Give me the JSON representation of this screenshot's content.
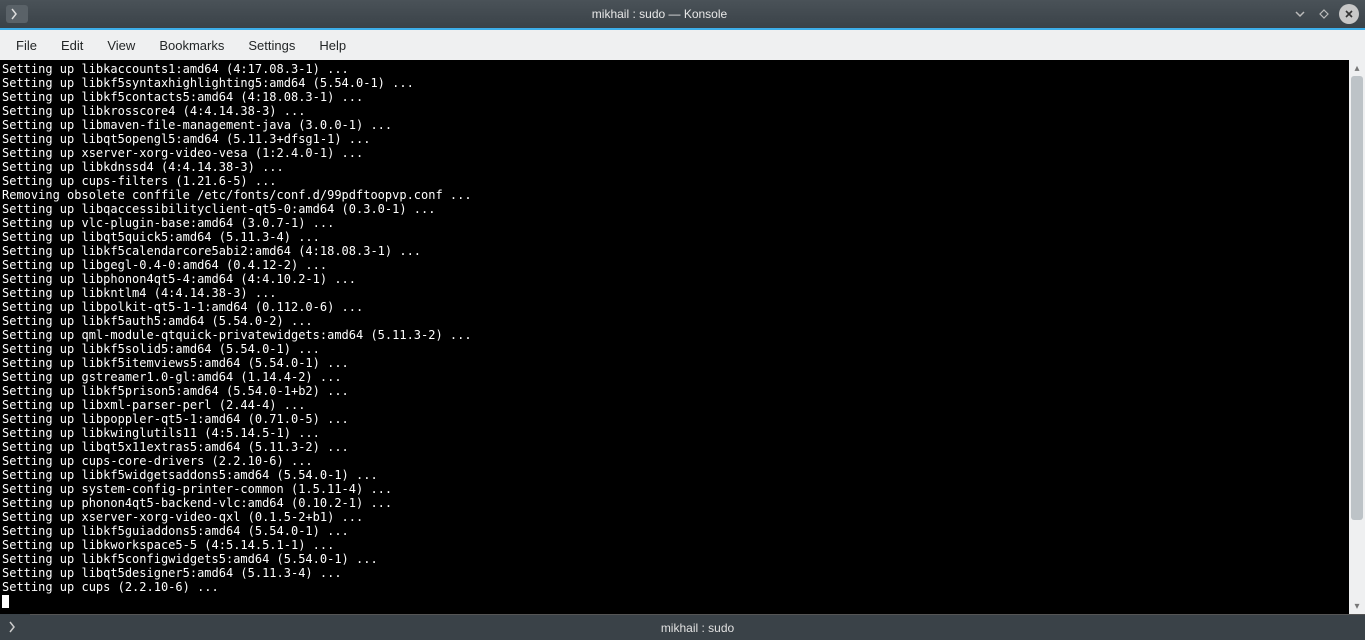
{
  "titlebar": {
    "title": "mikhail : sudo — Konsole"
  },
  "menu": {
    "file": "File",
    "edit": "Edit",
    "view": "View",
    "bookmarks": "Bookmarks",
    "settings": "Settings",
    "help": "Help"
  },
  "terminal_lines": [
    "Setting up libkaccounts1:amd64 (4:17.08.3-1) ...",
    "Setting up libkf5syntaxhighlighting5:amd64 (5.54.0-1) ...",
    "Setting up libkf5contacts5:amd64 (4:18.08.3-1) ...",
    "Setting up libkrosscore4 (4:4.14.38-3) ...",
    "Setting up libmaven-file-management-java (3.0.0-1) ...",
    "Setting up libqt5opengl5:amd64 (5.11.3+dfsg1-1) ...",
    "Setting up xserver-xorg-video-vesa (1:2.4.0-1) ...",
    "Setting up libkdnssd4 (4:4.14.38-3) ...",
    "Setting up cups-filters (1.21.6-5) ...",
    "Removing obsolete conffile /etc/fonts/conf.d/99pdftoopvp.conf ...",
    "Setting up libqaccessibilityclient-qt5-0:amd64 (0.3.0-1) ...",
    "Setting up vlc-plugin-base:amd64 (3.0.7-1) ...",
    "Setting up libqt5quick5:amd64 (5.11.3-4) ...",
    "Setting up libkf5calendarcore5abi2:amd64 (4:18.08.3-1) ...",
    "Setting up libgegl-0.4-0:amd64 (0.4.12-2) ...",
    "Setting up libphonon4qt5-4:amd64 (4:4.10.2-1) ...",
    "Setting up libkntlm4 (4:4.14.38-3) ...",
    "Setting up libpolkit-qt5-1-1:amd64 (0.112.0-6) ...",
    "Setting up libkf5auth5:amd64 (5.54.0-2) ...",
    "Setting up qml-module-qtquick-privatewidgets:amd64 (5.11.3-2) ...",
    "Setting up libkf5solid5:amd64 (5.54.0-1) ...",
    "Setting up libkf5itemviews5:amd64 (5.54.0-1) ...",
    "Setting up gstreamer1.0-gl:amd64 (1.14.4-2) ...",
    "Setting up libkf5prison5:amd64 (5.54.0-1+b2) ...",
    "Setting up libxml-parser-perl (2.44-4) ...",
    "Setting up libpoppler-qt5-1:amd64 (0.71.0-5) ...",
    "Setting up libkwinglutils11 (4:5.14.5-1) ...",
    "Setting up libqt5x11extras5:amd64 (5.11.3-2) ...",
    "Setting up cups-core-drivers (2.2.10-6) ...",
    "Setting up libkf5widgetsaddons5:amd64 (5.54.0-1) ...",
    "Setting up system-config-printer-common (1.5.11-4) ...",
    "Setting up phonon4qt5-backend-vlc:amd64 (0.10.2-1) ...",
    "Setting up xserver-xorg-video-qxl (0.1.5-2+b1) ...",
    "Setting up libkf5guiaddons5:amd64 (5.54.0-1) ...",
    "Setting up libkworkspace5-5 (4:5.14.5.1-1) ...",
    "Setting up libkf5configwidgets5:amd64 (5.54.0-1) ...",
    "Setting up libqt5designer5:amd64 (5.11.3-4) ...",
    "Setting up cups (2.2.10-6) ..."
  ],
  "tab": {
    "label": "mikhail : sudo"
  }
}
